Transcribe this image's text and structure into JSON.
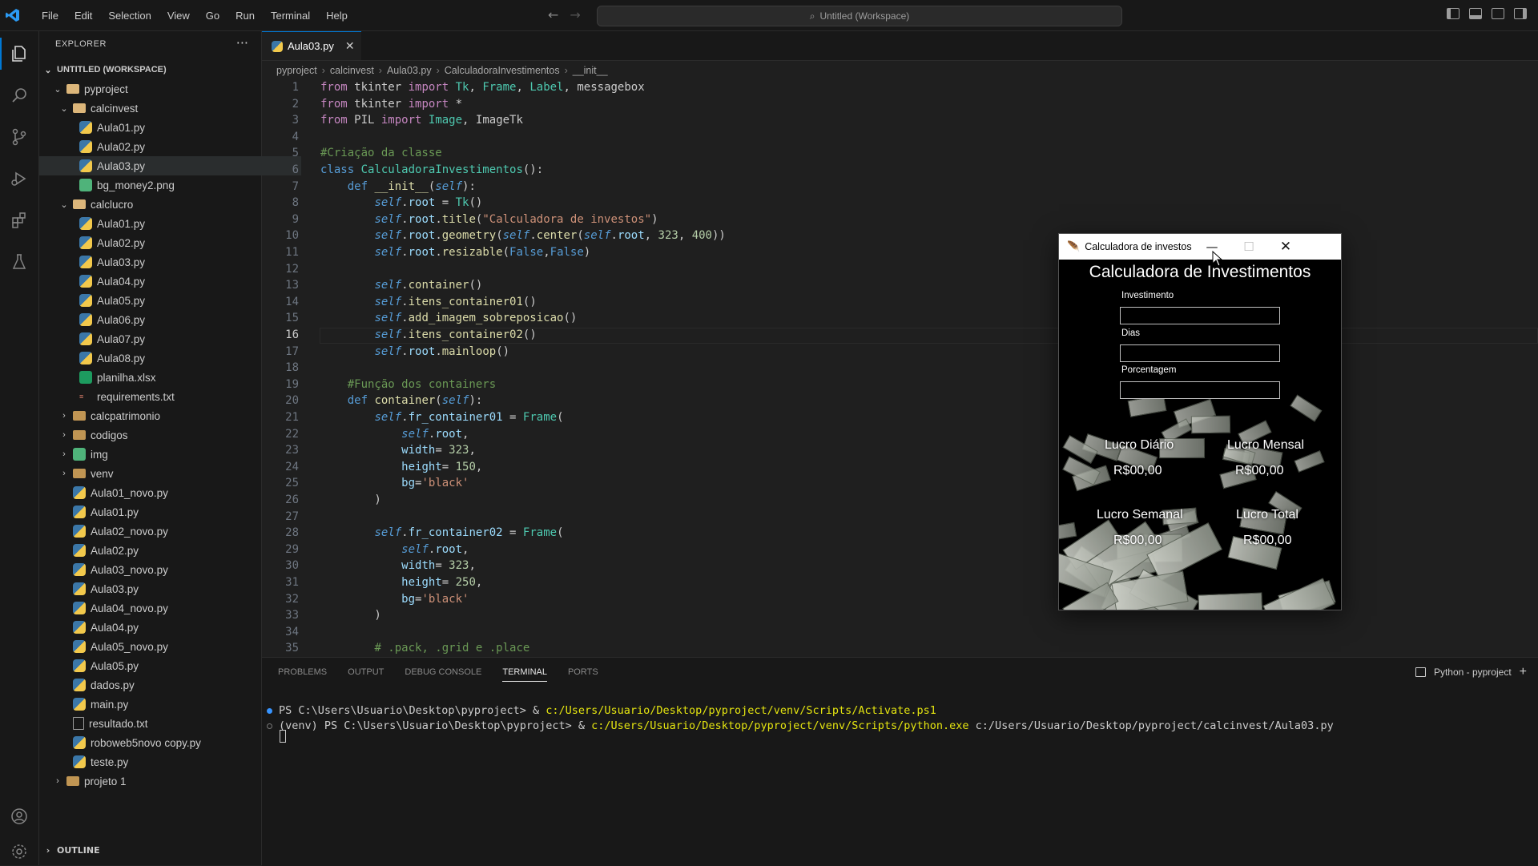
{
  "menu": [
    "File",
    "Edit",
    "Selection",
    "View",
    "Go",
    "Run",
    "Terminal",
    "Help"
  ],
  "command_center": "Untitled (Workspace)",
  "explorer": {
    "title": "EXPLORER",
    "workspace": "UNTITLED (WORKSPACE)",
    "tree": [
      {
        "label": "pyproject",
        "type": "folder-open",
        "depth": 0,
        "chev": "v"
      },
      {
        "label": "calcinvest",
        "type": "folder-open",
        "depth": 1,
        "chev": "v"
      },
      {
        "label": "Aula01.py",
        "type": "py",
        "depth": 2
      },
      {
        "label": "Aula02.py",
        "type": "py",
        "depth": 2
      },
      {
        "label": "Aula03.py",
        "type": "py",
        "depth": 2,
        "selected": true
      },
      {
        "label": "bg_money2.png",
        "type": "img",
        "depth": 2
      },
      {
        "label": "calclucro",
        "type": "folder-open",
        "depth": 1,
        "chev": "v"
      },
      {
        "label": "Aula01.py",
        "type": "py",
        "depth": 2
      },
      {
        "label": "Aula02.py",
        "type": "py",
        "depth": 2
      },
      {
        "label": "Aula03.py",
        "type": "py",
        "depth": 2
      },
      {
        "label": "Aula04.py",
        "type": "py",
        "depth": 2
      },
      {
        "label": "Aula05.py",
        "type": "py",
        "depth": 2
      },
      {
        "label": "Aula06.py",
        "type": "py",
        "depth": 2
      },
      {
        "label": "Aula07.py",
        "type": "py",
        "depth": 2
      },
      {
        "label": "Aula08.py",
        "type": "py",
        "depth": 2
      },
      {
        "label": "planilha.xlsx",
        "type": "xls",
        "depth": 2
      },
      {
        "label": "requirements.txt",
        "type": "req",
        "depth": 2
      },
      {
        "label": "calcpatrimonio",
        "type": "folder",
        "depth": 1,
        "chev": ">"
      },
      {
        "label": "codigos",
        "type": "folder",
        "depth": 1,
        "chev": ">"
      },
      {
        "label": "img",
        "type": "img",
        "depth": 1,
        "chev": ">"
      },
      {
        "label": "venv",
        "type": "folder",
        "depth": 1,
        "chev": ">"
      },
      {
        "label": "Aula01_novo.py",
        "type": "py",
        "depth": 1
      },
      {
        "label": "Aula01.py",
        "type": "py",
        "depth": 1
      },
      {
        "label": "Aula02_novo.py",
        "type": "py",
        "depth": 1
      },
      {
        "label": "Aula02.py",
        "type": "py",
        "depth": 1
      },
      {
        "label": "Aula03_novo.py",
        "type": "py",
        "depth": 1
      },
      {
        "label": "Aula03.py",
        "type": "py",
        "depth": 1
      },
      {
        "label": "Aula04_novo.py",
        "type": "py",
        "depth": 1
      },
      {
        "label": "Aula04.py",
        "type": "py",
        "depth": 1
      },
      {
        "label": "Aula05_novo.py",
        "type": "py",
        "depth": 1
      },
      {
        "label": "Aula05.py",
        "type": "py",
        "depth": 1
      },
      {
        "label": "dados.py",
        "type": "py",
        "depth": 1
      },
      {
        "label": "main.py",
        "type": "py",
        "depth": 1
      },
      {
        "label": "resultado.txt",
        "type": "txt",
        "depth": 1
      },
      {
        "label": "roboweb5novo copy.py",
        "type": "py",
        "depth": 1
      },
      {
        "label": "teste.py",
        "type": "py",
        "depth": 1
      },
      {
        "label": "projeto 1",
        "type": "folder",
        "depth": 0,
        "chev": ">"
      }
    ],
    "outline": "OUTLINE"
  },
  "editor": {
    "tab": "Aula03.py",
    "breadcrumb": [
      "pyproject",
      "calcinvest",
      "Aula03.py",
      "CalculadoraInvestimentos",
      "__init__"
    ],
    "current_line": 16,
    "lines": [
      [
        [
          "k",
          "from "
        ],
        [
          "t",
          "tkinter "
        ],
        [
          "k",
          "import "
        ],
        [
          "c",
          "Tk"
        ],
        [
          "t",
          ", "
        ],
        [
          "c",
          "Frame"
        ],
        [
          "t",
          ", "
        ],
        [
          "c",
          "Label"
        ],
        [
          "t",
          ", messagebox"
        ]
      ],
      [
        [
          "k",
          "from "
        ],
        [
          "t",
          "tkinter "
        ],
        [
          "k",
          "import "
        ],
        [
          "t",
          "*"
        ]
      ],
      [
        [
          "k",
          "from "
        ],
        [
          "t",
          "PIL "
        ],
        [
          "k",
          "import "
        ],
        [
          "c",
          "Image"
        ],
        [
          "t",
          ", ImageTk"
        ]
      ],
      [],
      [
        [
          "cm",
          "#Criação da classe"
        ]
      ],
      [
        [
          "b",
          "class "
        ],
        [
          "c",
          "CalculadoraInvestimentos"
        ],
        [
          "t",
          "():"
        ]
      ],
      [
        [
          "t",
          "    "
        ],
        [
          "b",
          "def "
        ],
        [
          "f",
          "__init__"
        ],
        [
          "t",
          "("
        ],
        [
          "sl",
          "self"
        ],
        [
          "t",
          "):"
        ]
      ],
      [
        [
          "t",
          "        "
        ],
        [
          "sl",
          "self"
        ],
        [
          "t",
          "."
        ],
        [
          "v",
          "root"
        ],
        [
          "t",
          " = "
        ],
        [
          "c",
          "Tk"
        ],
        [
          "t",
          "()"
        ]
      ],
      [
        [
          "t",
          "        "
        ],
        [
          "sl",
          "self"
        ],
        [
          "t",
          "."
        ],
        [
          "v",
          "root"
        ],
        [
          "t",
          "."
        ],
        [
          "f",
          "title"
        ],
        [
          "t",
          "("
        ],
        [
          "s",
          "\"Calculadora de investos\""
        ],
        [
          "t",
          ")"
        ]
      ],
      [
        [
          "t",
          "        "
        ],
        [
          "sl",
          "self"
        ],
        [
          "t",
          "."
        ],
        [
          "v",
          "root"
        ],
        [
          "t",
          "."
        ],
        [
          "f",
          "geometry"
        ],
        [
          "t",
          "("
        ],
        [
          "sl",
          "self"
        ],
        [
          "t",
          "."
        ],
        [
          "f",
          "center"
        ],
        [
          "t",
          "("
        ],
        [
          "sl",
          "self"
        ],
        [
          "t",
          "."
        ],
        [
          "v",
          "root"
        ],
        [
          "t",
          ", "
        ],
        [
          "n",
          "323"
        ],
        [
          "t",
          ", "
        ],
        [
          "n",
          "400"
        ],
        [
          "t",
          "))"
        ]
      ],
      [
        [
          "t",
          "        "
        ],
        [
          "sl",
          "self"
        ],
        [
          "t",
          "."
        ],
        [
          "v",
          "root"
        ],
        [
          "t",
          "."
        ],
        [
          "f",
          "resizable"
        ],
        [
          "t",
          "("
        ],
        [
          "b",
          "False"
        ],
        [
          "t",
          ","
        ],
        [
          "b",
          "False"
        ],
        [
          "t",
          ")"
        ]
      ],
      [],
      [
        [
          "t",
          "        "
        ],
        [
          "sl",
          "self"
        ],
        [
          "t",
          "."
        ],
        [
          "f",
          "container"
        ],
        [
          "t",
          "()"
        ]
      ],
      [
        [
          "t",
          "        "
        ],
        [
          "sl",
          "self"
        ],
        [
          "t",
          "."
        ],
        [
          "f",
          "itens_container01"
        ],
        [
          "t",
          "()"
        ]
      ],
      [
        [
          "t",
          "        "
        ],
        [
          "sl",
          "self"
        ],
        [
          "t",
          "."
        ],
        [
          "f",
          "add_imagem_sobreposicao"
        ],
        [
          "t",
          "()"
        ]
      ],
      [
        [
          "t",
          "        "
        ],
        [
          "sl",
          "self"
        ],
        [
          "t",
          "."
        ],
        [
          "f",
          "itens_container02"
        ],
        [
          "t",
          "()"
        ]
      ],
      [
        [
          "t",
          "        "
        ],
        [
          "sl",
          "self"
        ],
        [
          "t",
          "."
        ],
        [
          "v",
          "root"
        ],
        [
          "t",
          "."
        ],
        [
          "f",
          "mainloop"
        ],
        [
          "t",
          "()"
        ]
      ],
      [],
      [
        [
          "t",
          "    "
        ],
        [
          "cm",
          "#Função dos containers"
        ]
      ],
      [
        [
          "t",
          "    "
        ],
        [
          "b",
          "def "
        ],
        [
          "f",
          "container"
        ],
        [
          "t",
          "("
        ],
        [
          "sl",
          "self"
        ],
        [
          "t",
          "):"
        ]
      ],
      [
        [
          "t",
          "        "
        ],
        [
          "sl",
          "self"
        ],
        [
          "t",
          "."
        ],
        [
          "v",
          "fr_container01"
        ],
        [
          "t",
          " = "
        ],
        [
          "c",
          "Frame"
        ],
        [
          "t",
          "("
        ]
      ],
      [
        [
          "t",
          "            "
        ],
        [
          "sl",
          "self"
        ],
        [
          "t",
          "."
        ],
        [
          "v",
          "root"
        ],
        [
          "t",
          ","
        ]
      ],
      [
        [
          "t",
          "            "
        ],
        [
          "v",
          "width"
        ],
        [
          "t",
          "= "
        ],
        [
          "n",
          "323"
        ],
        [
          "t",
          ","
        ]
      ],
      [
        [
          "t",
          "            "
        ],
        [
          "v",
          "height"
        ],
        [
          "t",
          "= "
        ],
        [
          "n",
          "150"
        ],
        [
          "t",
          ","
        ]
      ],
      [
        [
          "t",
          "            "
        ],
        [
          "v",
          "bg"
        ],
        [
          "t",
          "="
        ],
        [
          "s",
          "'black'"
        ]
      ],
      [
        [
          "t",
          "        )"
        ]
      ],
      [],
      [
        [
          "t",
          "        "
        ],
        [
          "sl",
          "self"
        ],
        [
          "t",
          "."
        ],
        [
          "v",
          "fr_container02"
        ],
        [
          "t",
          " = "
        ],
        [
          "c",
          "Frame"
        ],
        [
          "t",
          "("
        ]
      ],
      [
        [
          "t",
          "            "
        ],
        [
          "sl",
          "self"
        ],
        [
          "t",
          "."
        ],
        [
          "v",
          "root"
        ],
        [
          "t",
          ","
        ]
      ],
      [
        [
          "t",
          "            "
        ],
        [
          "v",
          "width"
        ],
        [
          "t",
          "= "
        ],
        [
          "n",
          "323"
        ],
        [
          "t",
          ","
        ]
      ],
      [
        [
          "t",
          "            "
        ],
        [
          "v",
          "height"
        ],
        [
          "t",
          "= "
        ],
        [
          "n",
          "250"
        ],
        [
          "t",
          ","
        ]
      ],
      [
        [
          "t",
          "            "
        ],
        [
          "v",
          "bg"
        ],
        [
          "t",
          "="
        ],
        [
          "s",
          "'black'"
        ]
      ],
      [
        [
          "t",
          "        )"
        ]
      ],
      [],
      [
        [
          "t",
          "        "
        ],
        [
          "cm",
          "# .pack, .grid e .place"
        ]
      ]
    ]
  },
  "panel": {
    "tabs": [
      "PROBLEMS",
      "OUTPUT",
      "DEBUG CONSOLE",
      "TERMINAL",
      "PORTS"
    ],
    "active_tab": "TERMINAL",
    "terminal_name": "Python - pyproject",
    "terminal": [
      {
        "dot": "#3794ff",
        "prefix": "PS C:\\Users\\Usuario\\Desktop\\pyproject> & ",
        "path": "c:/Users/Usuario/Desktop/pyproject/venv/Scripts/Activate.ps1",
        "suffix": ""
      },
      {
        "dot": "#777777",
        "prefix": "(venv) PS C:\\Users\\Usuario\\Desktop\\pyproject> & ",
        "path": "c:/Users/Usuario/Desktop/pyproject/venv/Scripts/python.exe",
        "suffix": " c:/Users/Usuario/Desktop/pyproject/calcinvest/Aula03.py"
      }
    ]
  },
  "tkwindow": {
    "title": "Calculadora de investos",
    "heading": "Calculadora de Investimentos",
    "fields": [
      "Investimento",
      "Dias",
      "Porcentagem"
    ],
    "results": {
      "diario_label": "Lucro Diário",
      "diario_value": "R$00,00",
      "mensal_label": "Lucro Mensal",
      "mensal_value": "R$00,00",
      "semanal_label": "Lucro Semanal",
      "semanal_value": "R$00,00",
      "total_label": "Lucro Total",
      "total_value": "R$00,00"
    }
  }
}
